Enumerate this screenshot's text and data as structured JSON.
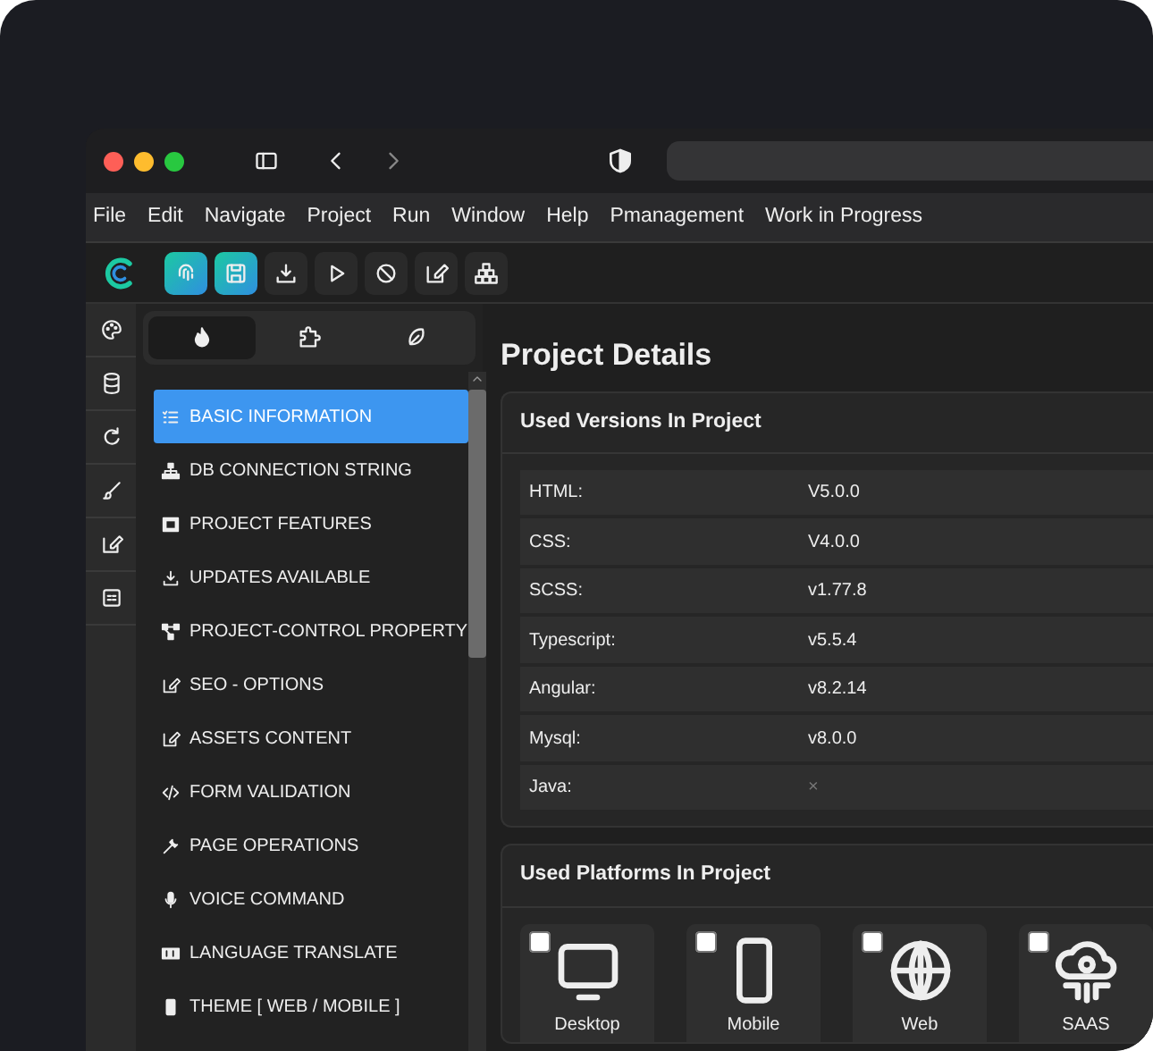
{
  "menu": [
    "File",
    "Edit",
    "Navigate",
    "Project",
    "Run",
    "Window",
    "Help",
    "Pmanagement",
    "Work in Progress"
  ],
  "toolbar": [
    {
      "selected": true
    },
    {
      "selected": true
    },
    {
      "selected": false
    },
    {
      "selected": false
    },
    {
      "selected": false
    },
    {
      "selected": false
    },
    {
      "selected": false
    }
  ],
  "panel_tabs": [
    {
      "selected": true
    },
    {
      "selected": false
    },
    {
      "selected": false
    }
  ],
  "nav_items": [
    {
      "label": "BASIC INFORMATION",
      "selected": true
    },
    {
      "label": "DB CONNECTION STRING",
      "selected": false
    },
    {
      "label": "PROJECT FEATURES",
      "selected": false
    },
    {
      "label": "UPDATES AVAILABLE",
      "selected": false
    },
    {
      "label": "PROJECT-CONTROL PROPERTY",
      "selected": false
    },
    {
      "label": "SEO - OPTIONS",
      "selected": false
    },
    {
      "label": "ASSETS CONTENT",
      "selected": false
    },
    {
      "label": "FORM VALIDATION",
      "selected": false
    },
    {
      "label": "PAGE OPERATIONS",
      "selected": false
    },
    {
      "label": "VOICE COMMAND",
      "selected": false
    },
    {
      "label": "LANGUAGE TRANSLATE",
      "selected": false
    },
    {
      "label": "THEME [ WEB / MOBILE ]",
      "selected": false
    }
  ],
  "page_title": "Project Details",
  "versions": {
    "title": "Used Versions In Project",
    "rows": [
      {
        "name": "HTML:",
        "value": "V5.0.0",
        "kind": "text"
      },
      {
        "name": "CSS:",
        "value": "V4.0.0",
        "kind": "text"
      },
      {
        "name": "SCSS:",
        "value": "v1.77.8",
        "kind": "text"
      },
      {
        "name": "Typescript:",
        "value": "v5.5.4",
        "kind": "text"
      },
      {
        "name": "Angular:",
        "value": "v8.2.14",
        "kind": "text"
      },
      {
        "name": "Mysql:",
        "value": "v8.0.0",
        "kind": "text"
      },
      {
        "name": "Java:",
        "value": "×",
        "kind": "missing"
      }
    ]
  },
  "platforms": {
    "title": "Used Platforms In Project",
    "items": [
      {
        "label": "Desktop",
        "checked": false
      },
      {
        "label": "Mobile",
        "checked": false
      },
      {
        "label": "Web",
        "checked": false
      },
      {
        "label": "SAAS",
        "checked": false
      }
    ]
  }
}
